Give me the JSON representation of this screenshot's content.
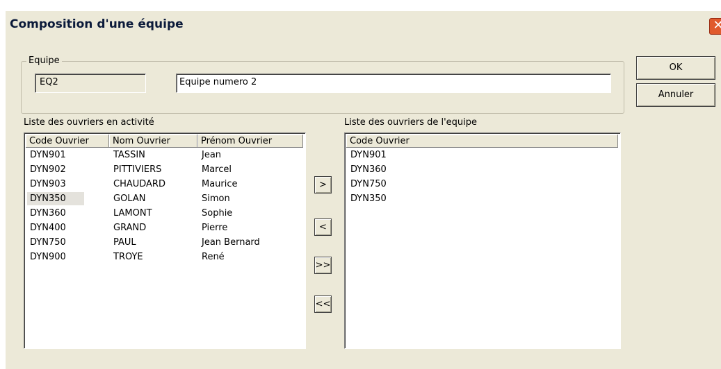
{
  "window": {
    "title": "Composition d'une équipe",
    "close_glyph": "✕"
  },
  "equipe": {
    "group_label": "Equipe",
    "code": "EQ2",
    "name": "Equipe numero 2"
  },
  "buttons": {
    "ok": "OK",
    "cancel": "Annuler"
  },
  "workers_list": {
    "label": "Liste des ouvriers en activité",
    "columns": [
      "Code Ouvrier",
      "Nom Ouvrier",
      "Prénom Ouvrier"
    ],
    "rows": [
      [
        "DYN901",
        "TASSIN",
        "Jean"
      ],
      [
        "DYN902",
        "PITTIVIERS",
        "Marcel"
      ],
      [
        "DYN903",
        "CHAUDARD",
        "Maurice"
      ],
      [
        "DYN350",
        "GOLAN",
        "Simon"
      ],
      [
        "DYN360",
        "LAMONT",
        "Sophie"
      ],
      [
        "DYN400",
        "GRAND",
        "Pierre"
      ],
      [
        "DYN750",
        "PAUL",
        "Jean Bernard"
      ],
      [
        "DYN900",
        "TROYE",
        "René"
      ]
    ],
    "highlighted_code": "DYN350"
  },
  "transfer_buttons": {
    "add": ">",
    "remove": "<",
    "add_all": ">>",
    "remove_all": "<<"
  },
  "team_list": {
    "label": "Liste des ouvriers de l'equipe",
    "columns": [
      "Code Ouvrier"
    ],
    "rows": [
      "DYN901",
      "DYN360",
      "DYN750",
      "DYN350"
    ]
  }
}
